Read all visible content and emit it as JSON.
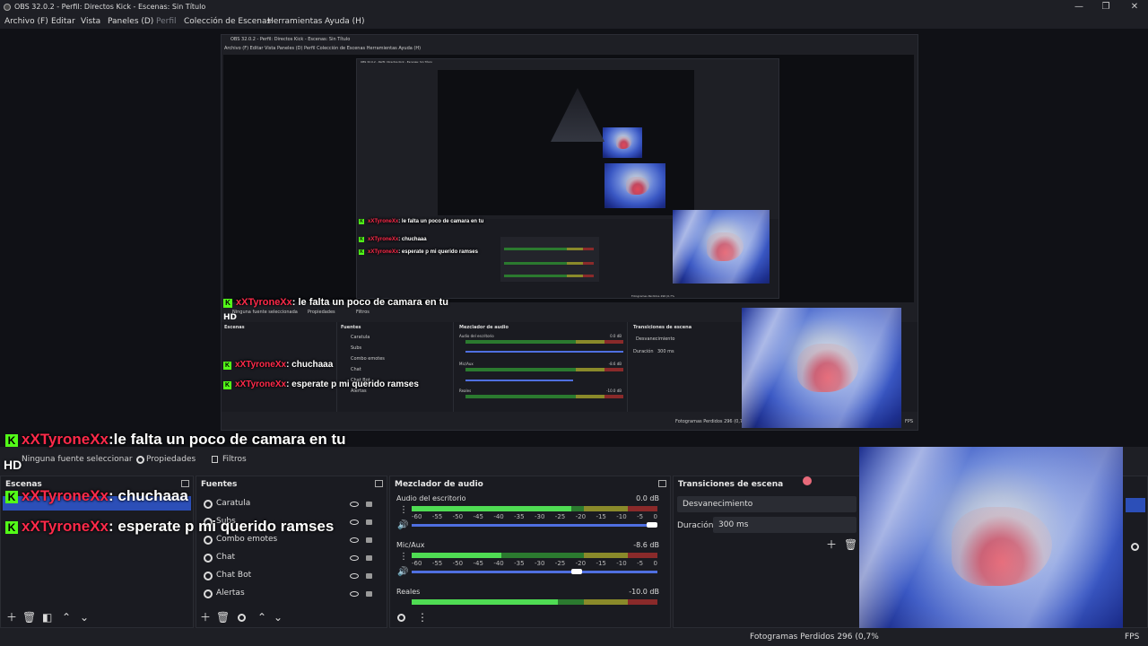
{
  "window": {
    "title": "OBS 32.0.2 - Perfil: Directos Kick - Escenas: Sin Título"
  },
  "menu": [
    "Archivo (F)",
    "Editar",
    "Vista",
    "Paneles (D)",
    "Perfil",
    "Colección de Escenas",
    "Herramientas",
    "Ayuda (H)"
  ],
  "nested1": {
    "title": "OBS 32.0.2 - Perfil: Directos Kick - Escenas: Sin Título",
    "menu": "Archivo (F)   Editar   Vista   Paneles (D)   Perfil   Colección de Escenas   Herramientas   Ayuda (H)",
    "no_source": "Ninguna fuente seleccionada",
    "props": "Propiedades",
    "filters": "Filtros",
    "scenes": "Escenas",
    "sources": "Fuentes",
    "mixer": "Mezclador de audio",
    "transitions": "Transiciones de escena",
    "desktop": "Audio del escritorio",
    "mic": "Mic/Aux",
    "reales": "Reales",
    "fade": "Desvanecimiento",
    "duration": "Duración",
    "duration_val": "300 ms",
    "status": "Fotogramas Perdidos 296 (0,7",
    "fps": "FPS",
    "source_items": [
      "Caratula",
      "Subs",
      "Combo emotes",
      "Chat",
      "Chat Bot",
      "Alertas"
    ],
    "db1": "0.0 dB",
    "db2": "-8.6 dB",
    "db3": "-10.0 dB"
  },
  "nested2": {
    "title": "OBS 32.0.2 - Perfil: Directos Kick - Escenas: Sin Título",
    "chat1": ": le falta un poco de camara en tu",
    "chat2": ": chuchaaa",
    "chat3": ": esperate p mi querido ramses",
    "user": "xXTyroneXx",
    "status": "Fotogramas Perdidos 296 (0,7%"
  },
  "chat": {
    "username": "xXTyroneXx",
    "messages": [
      ":le falta un poco de camara en tu",
      ": chuchaaa",
      ": esperate p mi querido ramses"
    ],
    "hd_label": "HD",
    "k_label": "K"
  },
  "toolbar": {
    "no_source": "Ninguna fuente seleccionar",
    "properties": "Propiedades",
    "filters": "Filtros"
  },
  "docks": {
    "scenes": {
      "title": "Escenas"
    },
    "sources": {
      "title": "Fuentes",
      "items": [
        "Caratula",
        "Subs",
        "Combo emotes",
        "Chat",
        "Chat Bot",
        "Alertas"
      ]
    },
    "mixer": {
      "title": "Mezclador de audio",
      "channels": [
        {
          "name": "Audio del escritorio",
          "db": "0.0 dB",
          "level": 0.93,
          "volume": 1.0
        },
        {
          "name": "Mic/Aux",
          "db": "-8.6 dB",
          "level": 0.52,
          "volume": 0.68
        },
        {
          "name": "Reales",
          "db": "-10.0 dB",
          "level": 0.85,
          "volume": 0.0
        }
      ],
      "scale": [
        "-60",
        "-55",
        "-50",
        "-45",
        "-40",
        "-35",
        "-30",
        "-25",
        "-20",
        "-15",
        "-10",
        "-5",
        "0"
      ]
    },
    "transitions": {
      "title": "Transiciones de escena",
      "selected": "Desvanecimiento",
      "duration_label": "Duración",
      "duration_value": "300 ms"
    }
  },
  "status": {
    "dropped": "Fotogramas Perdidos 296 (0,7%",
    "fps": "FPS"
  },
  "colors": {
    "kick_green": "#53fc18",
    "username_red": "#ff2a4a",
    "accent_blue": "#4f6fe0"
  }
}
